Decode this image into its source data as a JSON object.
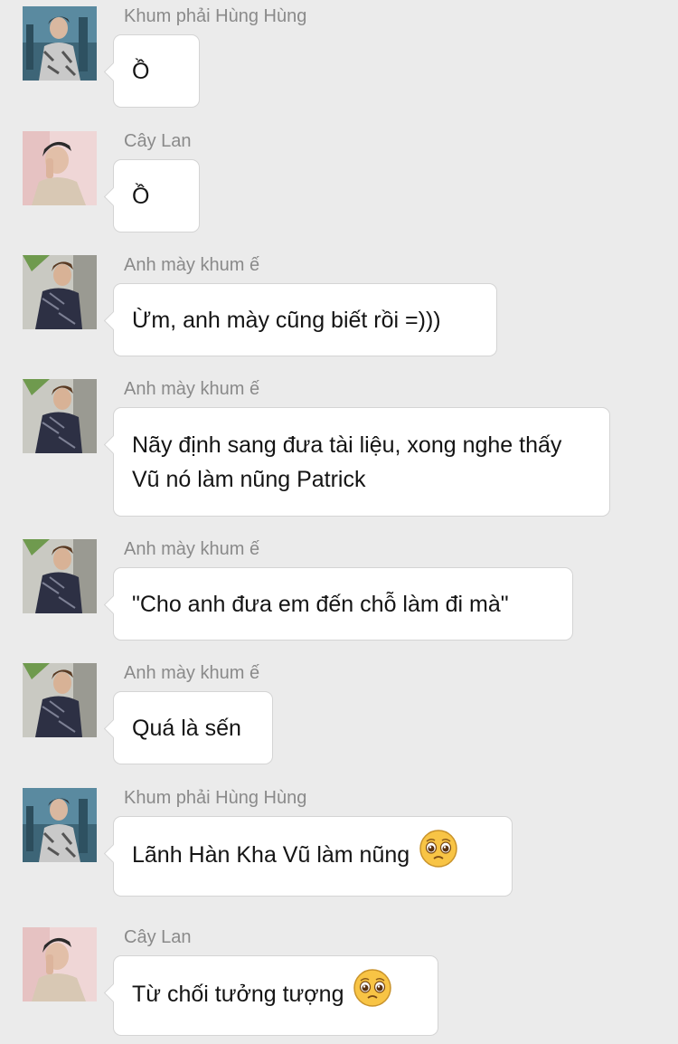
{
  "messages": [
    {
      "sender": "Khum phải Hùng Hùng",
      "text": "Ồ",
      "avatar": "hung-avatar",
      "emoji": null
    },
    {
      "sender": "Cây Lan",
      "text": "Ồ",
      "avatar": "caylan-avatar",
      "emoji": null
    },
    {
      "sender": "Anh mày khum ế",
      "text": "Ừm, anh mày cũng biết rồi =)))",
      "avatar": "anhmay-avatar",
      "emoji": null
    },
    {
      "sender": "Anh mày khum ế",
      "text": "Nãy định sang đưa tài liệu, xong nghe thấy Vũ nó làm nũng Patrick",
      "avatar": "anhmay-avatar",
      "emoji": null
    },
    {
      "sender": "Anh mày khum ế",
      "text": "\"Cho anh đưa em đến chỗ làm đi mà\"",
      "avatar": "anhmay-avatar",
      "emoji": null
    },
    {
      "sender": "Anh mày khum ế",
      "text": "Quá là sến",
      "avatar": "anhmay-avatar",
      "emoji": null
    },
    {
      "sender": "Khum phải Hùng Hùng",
      "text": "Lãnh Hàn Kha Vũ làm nũng",
      "avatar": "hung-avatar",
      "emoji": "pleading-face-emoji"
    },
    {
      "sender": "Cây Lan",
      "text": "Từ chối tưởng tượng",
      "avatar": "caylan-avatar",
      "emoji": "pleading-face-emoji"
    }
  ]
}
